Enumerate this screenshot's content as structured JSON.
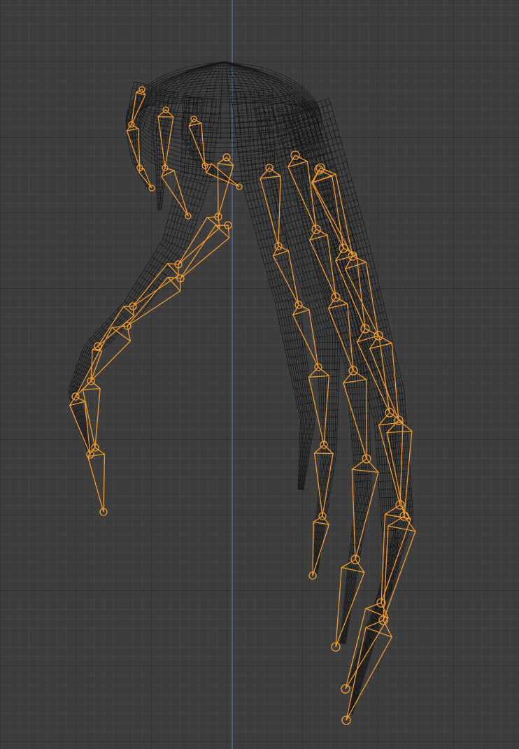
{
  "viewport": {
    "background_color": "#3d3d3d",
    "grid_minor_color": "#454545",
    "grid_major_color": "#2e2e2e",
    "axis_line_color": "#4d6fa8"
  },
  "mesh": {
    "kind": "hair-wireframe-mesh",
    "wire_color": "#161616"
  },
  "armature": {
    "kind": "hair-armature",
    "bone_color": "#f39b2a",
    "bone_display": "octahedral",
    "selected": true
  }
}
